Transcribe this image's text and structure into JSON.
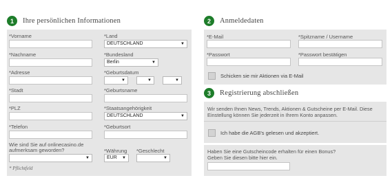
{
  "sections": {
    "personal": {
      "number": "1",
      "title": "Ihre persönlichen Informationen"
    },
    "login": {
      "number": "2",
      "title": "Anmeldedaten"
    },
    "registration": {
      "number": "3",
      "title": "Registrierung abschließen"
    }
  },
  "personal": {
    "first_name": "Vorname",
    "country": "Land",
    "country_value": "DEUTSCHLAND",
    "last_name": "Nachname",
    "state": "Bundesland",
    "state_value": "Berlin",
    "address": "Adresse",
    "birthdate": "Geburtsdatum",
    "city": "Stadt",
    "birth_name": "Geburtsname",
    "zip": "PLZ",
    "nationality": "Staatsangehörigkeit",
    "nationality_value": "DEUTSCHLAND",
    "phone": "Telefon",
    "birthplace": "Geburtsort",
    "referral_line1": "Wie sind Sie auf onlinecasino.de",
    "referral_line2": "aufmerksam geworden?",
    "currency": "Währung",
    "currency_value": "EUR",
    "gender": "Geschlecht",
    "required_note": "* Pflichtfeld"
  },
  "login": {
    "email": "E-Mail",
    "nickname": "Spitzname / Username",
    "password": "Passwort",
    "password_confirm": "Passwort bestätigen",
    "newsletter": "Schicken sie mir Aktionen via E-Mail"
  },
  "registration": {
    "info_line1": "Wir senden Ihnen News, Trends, Aktionen & Gutscheine per E-Mail. Diese",
    "info_line2": "Einstellung können Sie jederzeit in Ihrem Konto anpassen.",
    "agb": "Ich habe die AGB's gelesen und akzeptiert.",
    "bonus_line1": "Haben Sie eine Gutscheincode erhalten für einen Bonus?",
    "bonus_line2": "Geben Sie diesen bitte hier ein."
  },
  "colors": {
    "accent": "#1e7d2a",
    "panel": "#e6e6e6"
  }
}
